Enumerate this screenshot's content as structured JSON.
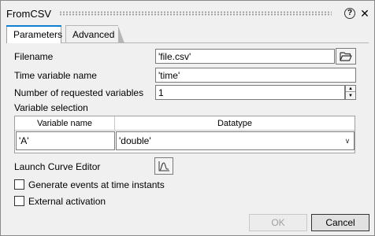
{
  "window": {
    "title": "FromCSV"
  },
  "tabs": [
    {
      "label": "Parameters",
      "active": true
    },
    {
      "label": "Advanced",
      "active": false
    }
  ],
  "fields": {
    "filename": {
      "label": "Filename",
      "value": "'file.csv'"
    },
    "time_var": {
      "label": "Time variable name",
      "value": "'time'"
    },
    "num_vars": {
      "label": "Number of requested variables",
      "value": "1"
    }
  },
  "variable_selection": {
    "label": "Variable selection",
    "columns": [
      "Variable name",
      "Datatype"
    ],
    "rows": [
      {
        "name": "'A'",
        "datatype": "'double'"
      }
    ]
  },
  "curve_editor": {
    "label": "Launch Curve Editor"
  },
  "checkboxes": {
    "generate_events": {
      "label": "Generate events at time instants",
      "checked": false
    },
    "external_activation": {
      "label": "External activation",
      "checked": false
    }
  },
  "buttons": {
    "ok": {
      "label": "OK",
      "enabled": false
    },
    "cancel": {
      "label": "Cancel",
      "enabled": true
    }
  },
  "colors": {
    "accent_tab": "#0f7fce",
    "background": "#f0f0f0"
  }
}
